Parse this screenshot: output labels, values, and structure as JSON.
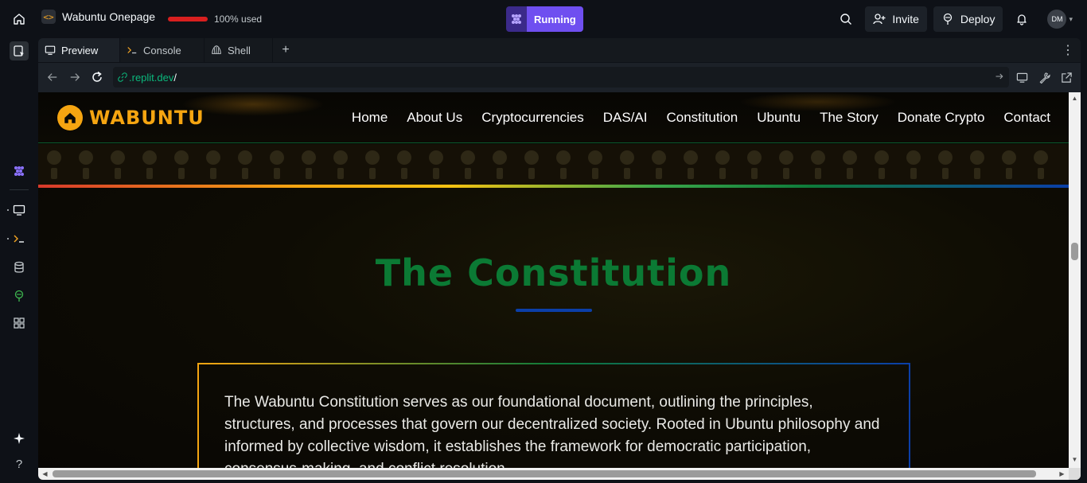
{
  "app": {
    "project_name": "Wabuntu Onepage",
    "usage_text": "100% used",
    "usage_fraction": 1.0,
    "run_status": "Running",
    "invite_label": "Invite",
    "deploy_label": "Deploy",
    "avatar_initials": "DM"
  },
  "tabs": [
    {
      "label": "Preview",
      "icon": "monitor-icon",
      "active": true
    },
    {
      "label": "Console",
      "icon": "terminal-icon",
      "active": false
    },
    {
      "label": "Shell",
      "icon": "shell-icon",
      "active": false
    }
  ],
  "url": {
    "domain": ".replit.dev",
    "path": "/"
  },
  "site": {
    "logo_text": "WABUNTU",
    "menu": [
      "Home",
      "About Us",
      "Cryptocurrencies",
      "DAS/AI",
      "Constitution",
      "Ubuntu",
      "The Story",
      "Donate Crypto",
      "Contact"
    ],
    "hero_title": "The Constitution",
    "card_text": "The Wabuntu Constitution serves as our foundational document, outlining the principles, structures, and processes that govern our decentralized society. Rooted in Ubuntu philosophy and informed by collective wisdom, it establishes the framework for democratic participation, consensus-making, and conflict resolution."
  },
  "colors": {
    "run_accent": "#6f4ff0",
    "url_domain": "#0bb87c",
    "logo": "#f5a511",
    "title": "#0b7a34",
    "underline": "#0b3fa8"
  }
}
